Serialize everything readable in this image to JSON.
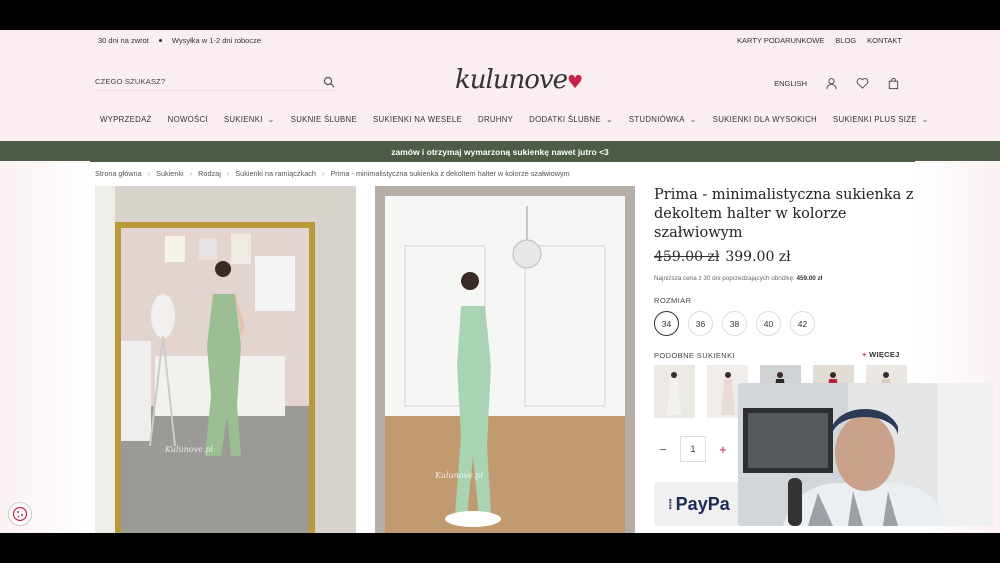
{
  "topbar": {
    "returns": "30 dni na zwrot",
    "shipping": "Wysyłka w 1-2 dni robocze",
    "links": [
      "KARTY PODARUNKOWE",
      "BLOG",
      "KONTAKT"
    ]
  },
  "header": {
    "search_placeholder": "CZEGO SZUKASZ?",
    "logo": "kulunove",
    "language": "ENGLISH"
  },
  "nav": [
    {
      "label": "WYPRZEDAŻ",
      "dropdown": false
    },
    {
      "label": "NOWOŚCI",
      "dropdown": false
    },
    {
      "label": "SUKIENKI",
      "dropdown": true
    },
    {
      "label": "SUKNIE ŚLUBNE",
      "dropdown": false
    },
    {
      "label": "SUKIENKI NA WESELE",
      "dropdown": false
    },
    {
      "label": "DRUHNY",
      "dropdown": false
    },
    {
      "label": "DODATKI ŚLUBNE",
      "dropdown": true
    },
    {
      "label": "STUDNIÓWKA",
      "dropdown": true
    },
    {
      "label": "SUKIENKI DLA WYSOKICH",
      "dropdown": false
    },
    {
      "label": "SUKIENKI PLUS SIZE",
      "dropdown": true
    }
  ],
  "promo": "zamów i otrzymaj wymarzoną sukienkę nawet jutro <3",
  "breadcrumb": [
    "Strona główna",
    "Sukienki",
    "Rodzaj",
    "Sukienki na ramiączkach",
    "Prima - minimalistyczna sukienka z dekoltem halter w kolorze szałwiowym"
  ],
  "product": {
    "title": "Prima - minimalistyczna sukienka z dekoltem halter w kolorze szałwiowym",
    "old_price": "459.00 zł",
    "new_price": "399.00 zł",
    "lowest_text": "Najniższa cena z 30 dni poprzedzających obniżkę:",
    "lowest_price": "459.00 zł",
    "size_label": "ROZMIAR",
    "sizes": [
      "34",
      "36",
      "38",
      "40",
      "42"
    ],
    "selected_size": "34",
    "similar_label": "PODOBNE SUKIENKI",
    "more_label": "WIĘCEJ",
    "quantity": "1",
    "paypal_label": "PayPa"
  },
  "colors": {
    "topbar_bg": "#fbeef0",
    "promo_bg": "#4e5b46",
    "accent": "#c8244a",
    "dress": "#9bbf93"
  }
}
